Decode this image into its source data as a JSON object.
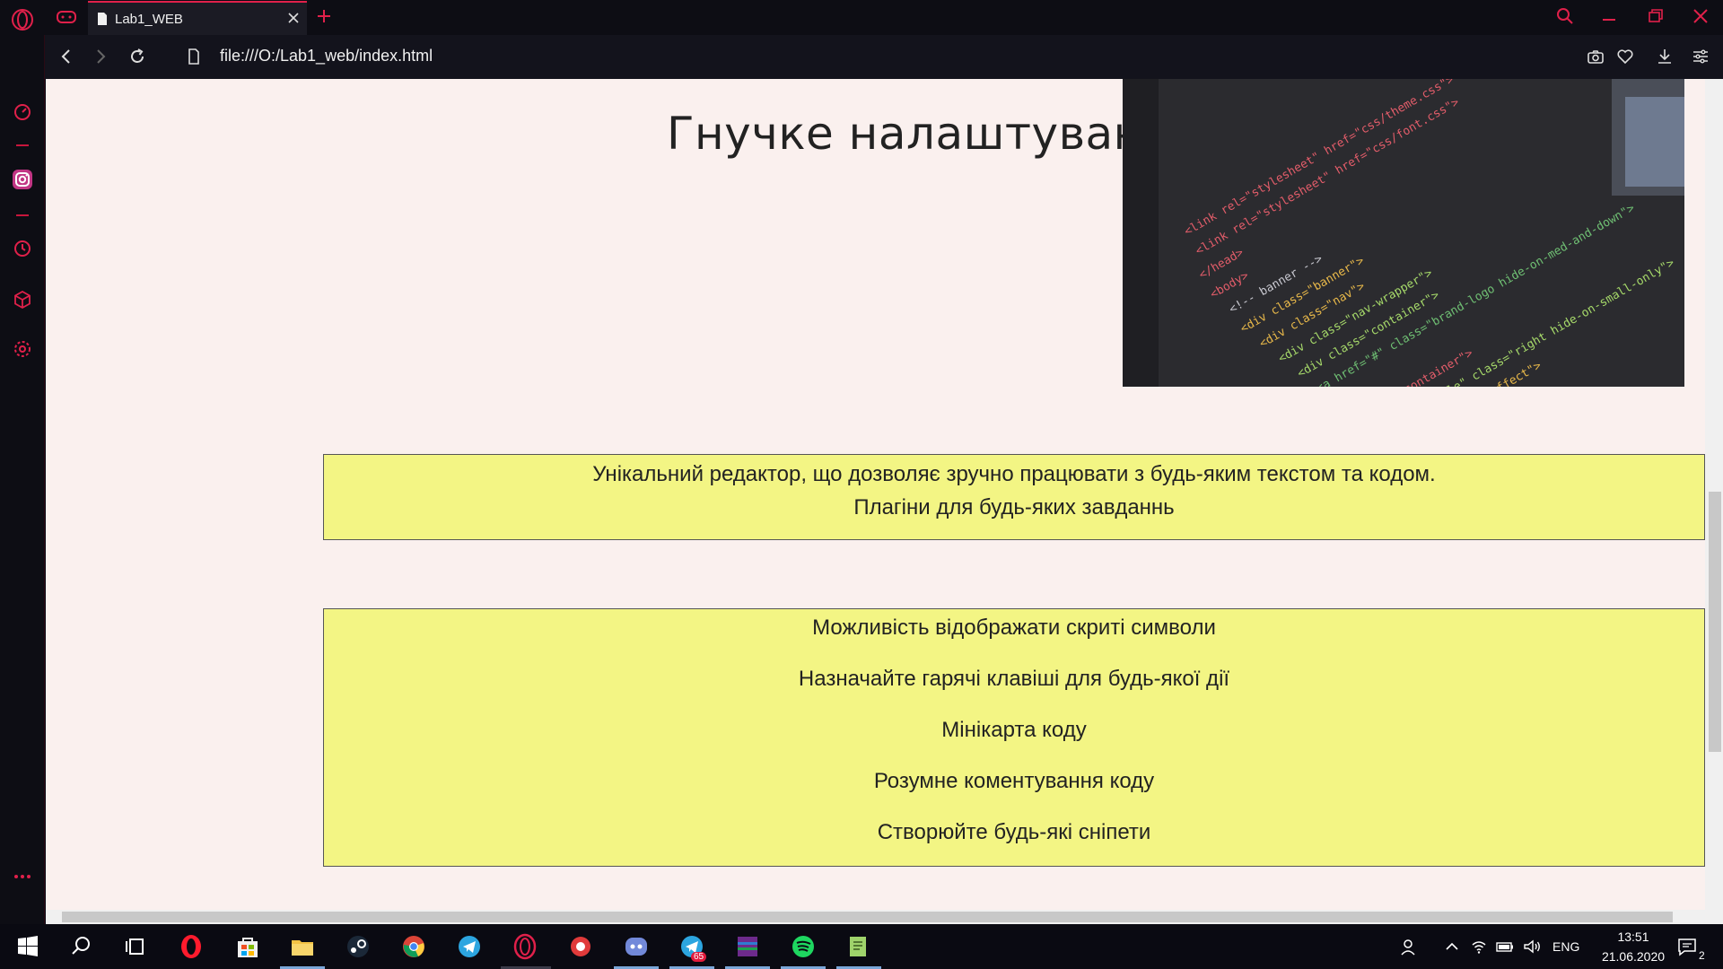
{
  "browser": {
    "tab_title": "Lab1_WEB",
    "url": "file:///O:/Lab1_web/index.html",
    "accent": "#e0204a"
  },
  "page": {
    "heading": "Гнучке налаштування",
    "background": "#faf0ee",
    "box_color": "#f3f584",
    "box1": [
      "Унікальний редактор, що дозволяє зручно працювати з будь-яким текстом та кодом.",
      "Плагіни для будь-яких завданнь"
    ],
    "box2": [
      "Можливість відображати скриті символи",
      "Назначайте гарячі клавіші для будь-якої дії",
      "Мінікарта коду",
      "Розумне коментування коду",
      "Створюйте будь-які сніпети"
    ]
  },
  "sidebar": {
    "icons": [
      "speed-dial-icon",
      "instagram-icon",
      "history-icon",
      "extensions-icon",
      "settings-icon",
      "more-icon"
    ]
  },
  "taskbar": {
    "apps": [
      "start-icon",
      "search-icon",
      "task-view-icon",
      "opera-icon",
      "store-icon",
      "file-explorer-icon",
      "steam-icon",
      "chrome-icon",
      "telegram-icon",
      "opera-gx-icon",
      "unknown-app-icon",
      "discord-icon",
      "telegram-desktop-icon",
      "winrar-icon",
      "spotify-icon",
      "notepad-icon"
    ],
    "telegram_badge": "65",
    "language": "ENG",
    "time": "13:51",
    "date": "21.06.2020",
    "notifications": "2"
  }
}
